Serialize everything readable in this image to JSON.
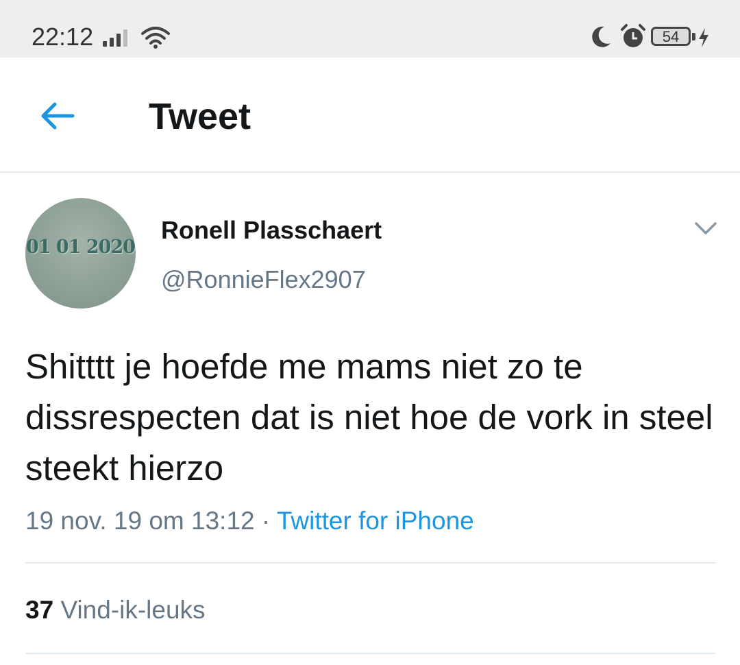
{
  "status_bar": {
    "time": "22:12",
    "battery": "54",
    "icons": [
      "signal-icon",
      "wifi-icon",
      "moon-icon",
      "alarm-icon",
      "battery-icon",
      "charging-bolt-icon"
    ]
  },
  "header": {
    "title": "Tweet",
    "back_icon": "back-arrow-icon"
  },
  "tweet": {
    "avatar_text": "01 01 2020",
    "display_name": "Ronell Plasschaert",
    "handle": "@RonnieFlex2907",
    "text": "Shitttt je hoefde me mams niet zo te dissrespecten dat is niet hoe de vork in steel steekt hierzo",
    "timestamp": "19 nov. 19 om 13:12",
    "separator": " · ",
    "source": "Twitter for iPhone",
    "likes_count": "37",
    "likes_label": "Vind-ik-leuks"
  },
  "colors": {
    "accent": "#1b95e0",
    "secondary_text": "#657786",
    "primary_text": "#14171a",
    "divider": "#e1e8ed",
    "status_bar_bg": "#eeeeee"
  }
}
